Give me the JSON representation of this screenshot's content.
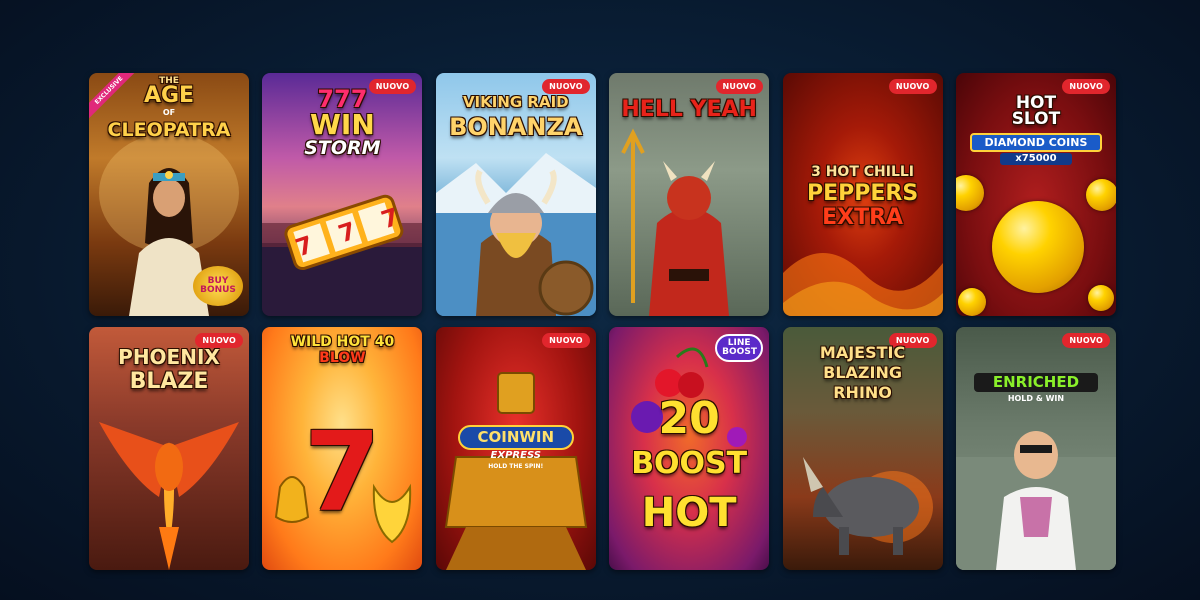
{
  "badge_label": "NUOVO",
  "games": [
    {
      "title_top": "THE",
      "title_main": "AGE",
      "title_of": "OF",
      "title_end": "CLEOPATRA",
      "ribbon": "EXCLUSIVE",
      "extra": "BUY BONUS",
      "new": false
    },
    {
      "title_top": "777",
      "title_main": "WIN",
      "title_end": "STORM",
      "reels": "7 7 7",
      "new": true
    },
    {
      "title_top": "VIKING RAID",
      "title_main": "BONANZA",
      "new": true
    },
    {
      "title_main": "HELL YEAH",
      "new": true
    },
    {
      "title_top": "3 HOT CHILLI",
      "title_main": "PEPPERS",
      "title_end": "EXTRA",
      "new": true
    },
    {
      "title_top": "HOT",
      "title_main": "SLOT",
      "title_end": "DIAMOND COINS",
      "extra": "x75000",
      "new": true
    },
    {
      "title_top": "PHOENIX",
      "title_main": "BLAZE",
      "new": true
    },
    {
      "title_top": "WILD HOT 40",
      "title_main": "BLOW",
      "symbol": "7",
      "new": false
    },
    {
      "title_top": "COINWIN",
      "title_main": "EXPRESS",
      "title_end": "HOLD THE SPIN!",
      "new": true
    },
    {
      "title_top": "20",
      "title_main": "BOOST",
      "title_end": "HOT",
      "extra": "LINE BOOST",
      "new": false
    },
    {
      "title_top": "MAJESTIC",
      "title_main": "BLAZING",
      "title_end": "RHINO",
      "new": true
    },
    {
      "title_main": "ENRICHED",
      "title_end": "HOLD & WIN",
      "new": true
    }
  ],
  "colors": {
    "badge": "#e1262d",
    "background": "#0a2038"
  }
}
